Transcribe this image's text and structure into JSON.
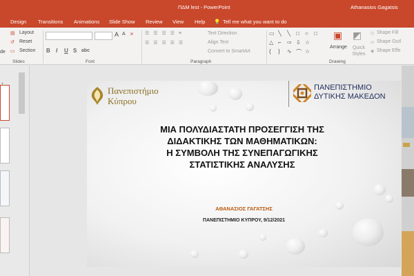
{
  "window": {
    "title": "ΠΔΜ lest  -  PowerPoint",
    "user": "Athanasios Gagatsis"
  },
  "tabs": [
    "Design",
    "Transitions",
    "Animations",
    "Slide Show",
    "Review",
    "View",
    "Help"
  ],
  "tell_me": "Tell me what you want to do",
  "ribbon": {
    "slides_group": {
      "layout": "Layout",
      "reset": "Reset",
      "section": "Section",
      "label": "Slides",
      "new_slide_partial": "de"
    },
    "font_group": {
      "label": "Font",
      "size_up": "A",
      "size_down": "A",
      "bold": "B",
      "italic": "I",
      "underline": "U",
      "strike": "S",
      "shadow": "abc"
    },
    "paragraph_group": {
      "label": "Paragraph",
      "text_direction": "Text Direction",
      "align_text": "Align Text",
      "convert_smartart": "Convert to SmartArt"
    },
    "drawing_group": {
      "label": "Drawing",
      "arrange": "Arrange",
      "quick_styles": "Quick Styles",
      "shape_fill": "Shape Fill",
      "shape_outline": "Shape Outl",
      "shape_effects": "Shape Effe"
    }
  },
  "slide": {
    "logo_left_line1": "Πανεπιστήμιο",
    "logo_left_line2": "Κύπρου",
    "logo_right_line1": "ΠΑΝΕΠΙΣΤΗΜΙΟ",
    "logo_right_line2": "ΔΥΤΙΚΗΣ ΜΑΚΕΔΟΝ",
    "title_lines": [
      "ΜΙΑ ΠΟΛΥΔΙΑΣΤΑΤΗ ΠΡΟΣΕΓΓΙΣΗ ΤΗΣ",
      "ΔΙΔΑΚΤΙΚΗΣ ΤΩΝ ΜΑΘΗΜΑΤΙΚΩΝ:",
      "Η ΣΥΜΒΟΛΗ ΤΗΣ ΣΥΝΕΠΑΓΩΓΙΚΗΣ",
      "ΣΤΑΤΙΣΤΙΚΗΣ ΑΝΑΛΥΣΗΣ"
    ],
    "author": "ΑΘΑΝΑΣΙΟΣ  ΓΑΓΑΤΣΗΣ",
    "affiliation": "ΠΑΝΕΠΙΣΤΗΜΙΟ ΚΥΠΡΟΥ, 9/12/2021"
  },
  "thumbnail_numbers": [
    "1"
  ],
  "colors": {
    "accent": "#c9472b",
    "author": "#b85a10",
    "logo_gold": "#8a6d1e",
    "logo_navy": "#1e2c5a"
  }
}
